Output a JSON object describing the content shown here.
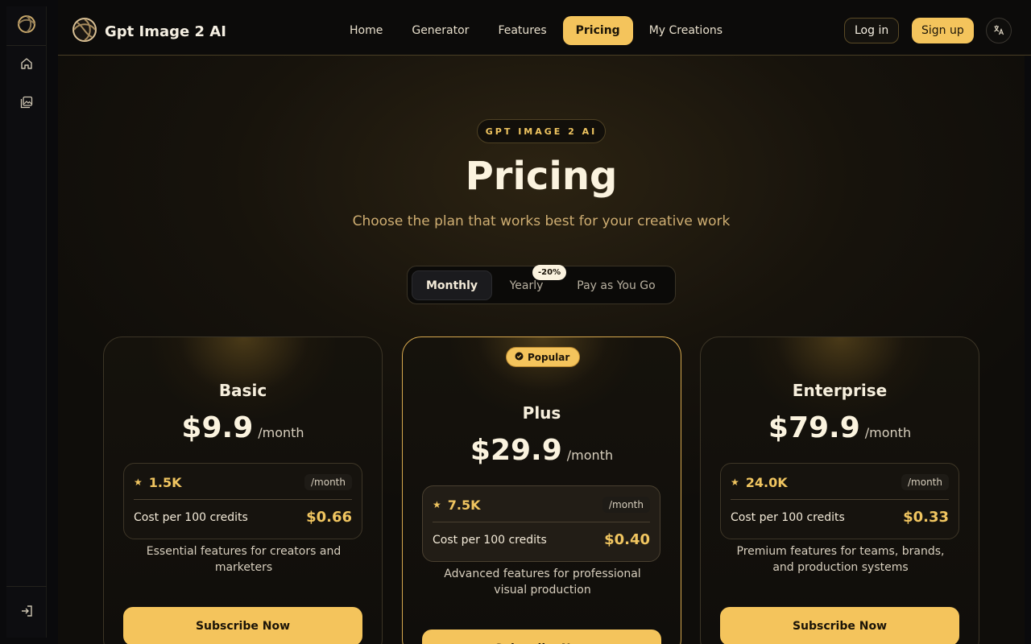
{
  "app": {
    "brand_name": "Gpt Image 2 AI"
  },
  "nav": {
    "items": [
      {
        "label": "Home",
        "active": false
      },
      {
        "label": "Generator",
        "active": false
      },
      {
        "label": "Features",
        "active": false
      },
      {
        "label": "Pricing",
        "active": true
      },
      {
        "label": "My Creations",
        "active": false
      }
    ],
    "login_label": "Log in",
    "signup_label": "Sign up"
  },
  "rail": {
    "icons": [
      "logo-icon",
      "home-icon",
      "gallery-icon",
      "login-icon"
    ]
  },
  "hero": {
    "badge": "GPT IMAGE 2 AI",
    "title": "Pricing",
    "subtitle": "Choose the plan that works best for your creative work"
  },
  "billing_toggle": {
    "options": [
      "Monthly",
      "Yearly",
      "Pay as You Go"
    ],
    "selected": "Monthly",
    "yearly_discount": "-20%"
  },
  "plans": [
    {
      "name": "Basic",
      "price": "$9.9",
      "period": "/month",
      "credits": "1.5K",
      "credits_unit": "/month",
      "cost_label": "Cost per 100 credits",
      "cost_value": "$0.66",
      "description": "Essential features for creators and marketers",
      "cta": "Subscribe Now",
      "popular": false
    },
    {
      "name": "Plus",
      "price": "$29.9",
      "period": "/month",
      "credits": "7.5K",
      "credits_unit": "/month",
      "cost_label": "Cost per 100 credits",
      "cost_value": "$0.40",
      "description": "Advanced features for professional visual production",
      "cta": "Subscribe Now",
      "popular": true,
      "popular_label": "Popular"
    },
    {
      "name": "Enterprise",
      "price": "$79.9",
      "period": "/month",
      "credits": "24.0K",
      "credits_unit": "/month",
      "cost_label": "Cost per 100 credits",
      "cost_value": "$0.33",
      "description": "Premium features for teams, brands, and production systems",
      "cta": "Subscribe Now",
      "popular": false
    }
  ],
  "colors": {
    "accent": "#f4c45c",
    "background": "#0a0a0c",
    "gold_text": "#f0c560"
  }
}
